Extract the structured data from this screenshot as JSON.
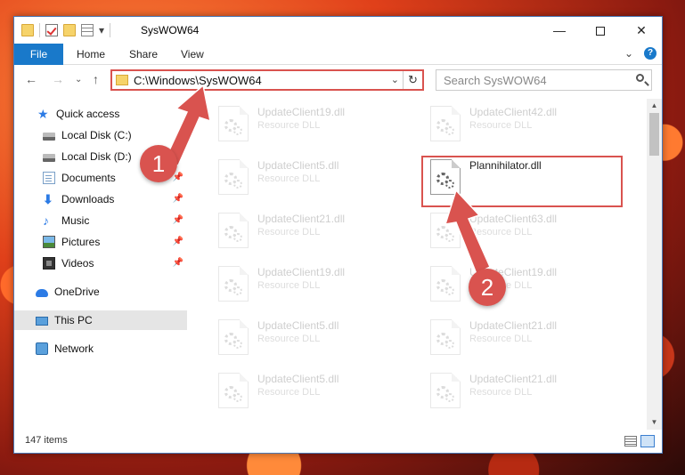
{
  "window": {
    "title": "SysWOW64",
    "minimize": "—",
    "maximize": "",
    "close": "✕"
  },
  "ribbon": {
    "file": "File",
    "home": "Home",
    "share": "Share",
    "view": "View"
  },
  "nav": {
    "back": "←",
    "forward": "→",
    "recent": "⌄",
    "up": "↑",
    "address": "C:\\Windows\\SysWOW64",
    "search_placeholder": "Search SysWOW64"
  },
  "sidebar": {
    "items": [
      {
        "label": "Quick access",
        "icon": "star-icon"
      },
      {
        "label": "Local Disk (C:)",
        "icon": "drive-icon"
      },
      {
        "label": "Local Disk (D:)",
        "icon": "drive-icon"
      },
      {
        "label": "Documents",
        "icon": "documents-icon"
      },
      {
        "label": "Downloads",
        "icon": "downloads-icon"
      },
      {
        "label": "Music",
        "icon": "music-icon"
      },
      {
        "label": "Pictures",
        "icon": "pictures-icon"
      },
      {
        "label": "Videos",
        "icon": "videos-icon"
      },
      {
        "label": "OneDrive",
        "icon": "cloud-icon"
      },
      {
        "label": "This PC",
        "icon": "computer-icon"
      },
      {
        "label": "Network",
        "icon": "network-icon"
      }
    ]
  },
  "files": [
    {
      "name": "UpdateClient19.dll",
      "type": "Resource DLL"
    },
    {
      "name": "UpdateClient42.dll",
      "type": "Resource DLL"
    },
    {
      "name": "UpdateClient5.dll",
      "type": "Resource DLL"
    },
    {
      "name": "Plannihilator.dll",
      "type": ""
    },
    {
      "name": "UpdateClient21.dll",
      "type": "Resource DLL"
    },
    {
      "name": "UpdateClient63.dll",
      "type": "Resource DLL"
    },
    {
      "name": "UpdateClient19.dll",
      "type": "Resource DLL"
    },
    {
      "name": "UpdateClient19.dll",
      "type": "Resource DLL"
    },
    {
      "name": "UpdateClient5.dll",
      "type": "Resource DLL"
    },
    {
      "name": "UpdateClient21.dll",
      "type": "Resource DLL"
    },
    {
      "name": "UpdateClient5.dll",
      "type": "Resource DLL"
    },
    {
      "name": "UpdateClient21.dll",
      "type": "Resource DLL"
    }
  ],
  "status": {
    "count": "147 items"
  },
  "annotations": {
    "step1": "1",
    "step2": "2",
    "color": "#d9534f"
  }
}
